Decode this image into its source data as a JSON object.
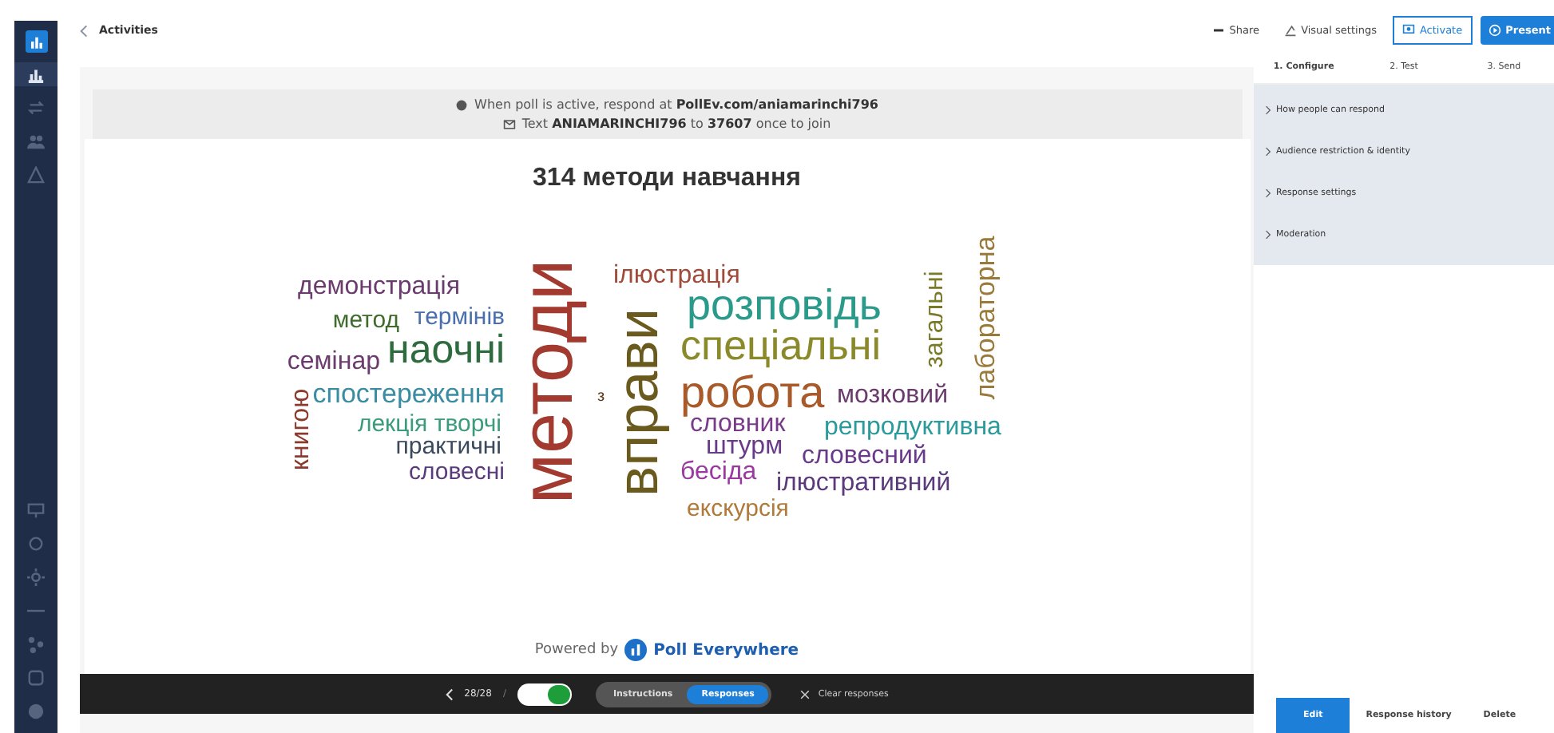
{
  "nav_icons": [
    {
      "kind": "chart",
      "selected": true
    },
    {
      "kind": "swap",
      "selected": false
    },
    {
      "kind": "people",
      "selected": false
    },
    {
      "kind": "triangle",
      "selected": false
    }
  ],
  "nav_bottom_icons": [
    {
      "kind": "present"
    },
    {
      "kind": "circle"
    },
    {
      "kind": "gear"
    },
    {
      "kind": "line"
    },
    {
      "kind": "network"
    },
    {
      "kind": "square"
    },
    {
      "kind": "dot"
    }
  ],
  "back_link": "Activities",
  "actions": [
    {
      "kind": "share",
      "label": "Share"
    },
    {
      "kind": "visual",
      "label": "Visual settings"
    },
    {
      "kind": "activate",
      "label": "Activate"
    },
    {
      "kind": "present",
      "label": "Present"
    }
  ],
  "banner": {
    "web": "When poll is active, respond at **PollEv.com/aniamarinchi796**",
    "text": "Text **ANIAMARINCHI796** to **37607** once to join"
  },
  "title": "314 методи навчання",
  "words": [
    {
      "text": "демонстрація",
      "color": "#6b3b6e"
    },
    {
      "text": "метод",
      "color": "#3f6b2c"
    },
    {
      "text": "термінів",
      "color": "#4a6fae"
    },
    {
      "text": "семінар",
      "color": "#6b3b6e"
    },
    {
      "text": "наочні",
      "color": "#2e6b3e"
    },
    {
      "text": "спостереження",
      "color": "#3a8ca3"
    },
    {
      "text": "лекція творчі",
      "color": "#3a9c7c"
    },
    {
      "text": "практичні",
      "color": "#3a4a5c"
    },
    {
      "text": "словесні",
      "color": "#5a3c7c"
    },
    {
      "text": "книгою",
      "color": "#8c3a2c"
    },
    {
      "text": "методи",
      "color": "#a23a30"
    },
    {
      "text": "з",
      "color": "#5a3a1a"
    },
    {
      "text": "вправи",
      "color": "#6b5a1e"
    },
    {
      "text": "ілюстрація",
      "color": "#a04a3a"
    },
    {
      "text": "розповідь",
      "color": "#2a9a8a"
    },
    {
      "text": "спеціальні",
      "color": "#8a8a2a"
    },
    {
      "text": "робота",
      "color": "#a85a2a"
    },
    {
      "text": "мозковий",
      "color": "#6b3b6e"
    },
    {
      "text": "словник",
      "color": "#7a3a8a"
    },
    {
      "text": "репродуктивна",
      "color": "#2a9a9a"
    },
    {
      "text": "штурм",
      "color": "#6a3a8a"
    },
    {
      "text": "словесний",
      "color": "#6a3a8a"
    },
    {
      "text": "бесіда",
      "color": "#9a3aa0"
    },
    {
      "text": "ілюстративний",
      "color": "#5a3a7a"
    },
    {
      "text": "екскурсія",
      "color": "#b07a3a"
    },
    {
      "text": "загальні",
      "color": "#7a7a2a"
    },
    {
      "text": "лабораторна",
      "color": "#9a7a3a"
    }
  ],
  "powered_by": "Powered by",
  "brand": "Poll Everywhere",
  "toolbar": {
    "counter": "28/28",
    "separator": "/",
    "toggle_on": true,
    "segments": [
      {
        "label": "Instructions",
        "selected": false
      },
      {
        "label": "Responses",
        "selected": true
      }
    ],
    "clear": "Clear responses"
  },
  "steps": [
    {
      "label": "1. Configure",
      "selected": true
    },
    {
      "label": "2. Test",
      "selected": false
    },
    {
      "label": "3. Send",
      "selected": false
    }
  ],
  "settings": [
    {
      "label": "How people can respond",
      "expanded": false
    },
    {
      "label": "Audience restriction & identity",
      "expanded": false
    },
    {
      "label": "Response settings",
      "expanded": false
    },
    {
      "label": "Moderation",
      "expanded": false
    }
  ],
  "bottom_tabs": [
    {
      "label": "Edit",
      "selected": true
    },
    {
      "label": "Response history",
      "selected": false
    },
    {
      "label": "Delete",
      "selected": false
    }
  ]
}
